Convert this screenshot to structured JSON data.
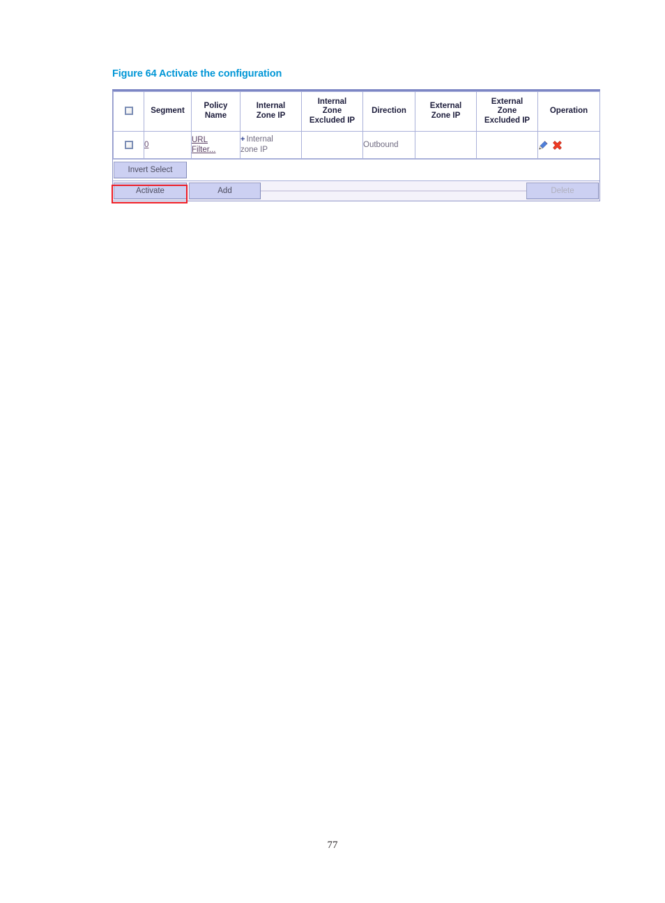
{
  "figure": {
    "caption": "Figure 64 Activate the configuration",
    "caption_color": "#0096d6"
  },
  "table": {
    "headers": [
      {
        "name": "select-all",
        "label": ""
      },
      {
        "name": "segment",
        "label": "Segment"
      },
      {
        "name": "policy-name",
        "label": "Policy Name"
      },
      {
        "name": "internal-zone-ip",
        "label": "Internal Zone IP"
      },
      {
        "name": "internal-zone-excluded-ip",
        "label": "Internal Zone Excluded IP"
      },
      {
        "name": "direction",
        "label": "Direction"
      },
      {
        "name": "external-zone-ip",
        "label": "External Zone IP"
      },
      {
        "name": "external-zone-excluded-ip",
        "label": "External Zone Excluded IP"
      },
      {
        "name": "operation",
        "label": "Operation"
      }
    ],
    "header_labels": {
      "segment": "Segment",
      "policy_name_l1": "Policy",
      "policy_name_l2": "Name",
      "internal_zone_ip_l1": "Internal",
      "internal_zone_ip_l2": "Zone IP",
      "internal_excluded_l1": "Internal",
      "internal_excluded_l2": "Zone",
      "internal_excluded_l3": "Excluded IP",
      "direction": "Direction",
      "external_zone_ip_l1": "External",
      "external_zone_ip_l2": "Zone IP",
      "external_excluded_l1": "External",
      "external_excluded_l2": "Zone",
      "external_excluded_l3": "Excluded IP",
      "operation": "Operation"
    },
    "rows": [
      {
        "segment": "0",
        "policy_name_l1": "URL",
        "policy_name_l2": "Filter...",
        "internal_zone_ip_plus": "+",
        "internal_zone_ip_l1": "Internal",
        "internal_zone_ip_l2": "zone IP",
        "internal_zone_excluded_ip": "",
        "direction": "Outbound",
        "external_zone_ip": "",
        "external_zone_excluded_ip": "",
        "operation_icons": [
          "edit-pencil-icon",
          "delete-cross-icon"
        ]
      }
    ]
  },
  "buttons": {
    "invert_select": "Invert Select",
    "activate": "Activate",
    "add": "Add",
    "delete": "Delete"
  },
  "annotation": {
    "target": "activate-button",
    "color": "#ee1c25"
  },
  "footer": {
    "page_number": "77"
  }
}
